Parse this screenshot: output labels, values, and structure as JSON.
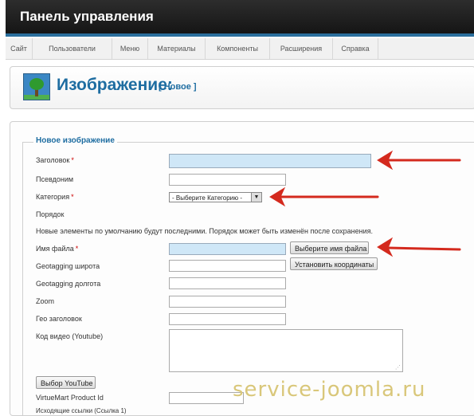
{
  "app": {
    "title": "Панель управления"
  },
  "menu": {
    "items": [
      "Сайт",
      "Пользователи",
      "Меню",
      "Материалы",
      "Компоненты",
      "Расширения",
      "Справка"
    ]
  },
  "header": {
    "title": "Изображение:",
    "subtitle": "[ Новое ]"
  },
  "form": {
    "legend": "Новое изображение",
    "fields": {
      "title": {
        "label": "Заголовок",
        "required_mark": "*",
        "value": ""
      },
      "alias": {
        "label": "Псевдоним",
        "value": ""
      },
      "category": {
        "label": "Категория",
        "required_mark": "*",
        "selected": "- Выберите Категорию -"
      },
      "order": {
        "label": "Порядок",
        "note": "Новые элементы по умолчанию будут последними. Порядок может быть изменён после сохранения."
      },
      "filename": {
        "label": "Имя файла",
        "required_mark": "*",
        "value": "",
        "button": "Выберите имя файла"
      },
      "geo_lat": {
        "label": "Geotagging широта",
        "value": "",
        "button": "Установить координаты"
      },
      "geo_lng": {
        "label": "Geotagging долгота",
        "value": ""
      },
      "zoom": {
        "label": "Zoom",
        "value": ""
      },
      "geo_title": {
        "label": "Гео заголовок",
        "value": ""
      },
      "video": {
        "label": "Код видео (Youtube)",
        "value": ""
      },
      "youtube_button": "Выбор YouTube",
      "vm_product": {
        "label": "VirtueMart Product Id",
        "value": ""
      },
      "outgoing": {
        "label": "Исходящие ссылки (Ссылка 1)"
      }
    }
  },
  "watermark": "service-joomla.ru",
  "colors": {
    "accent": "#1e6da1",
    "annotation_arrow": "#d42a1e",
    "highlight_field": "#cfe7f7"
  }
}
